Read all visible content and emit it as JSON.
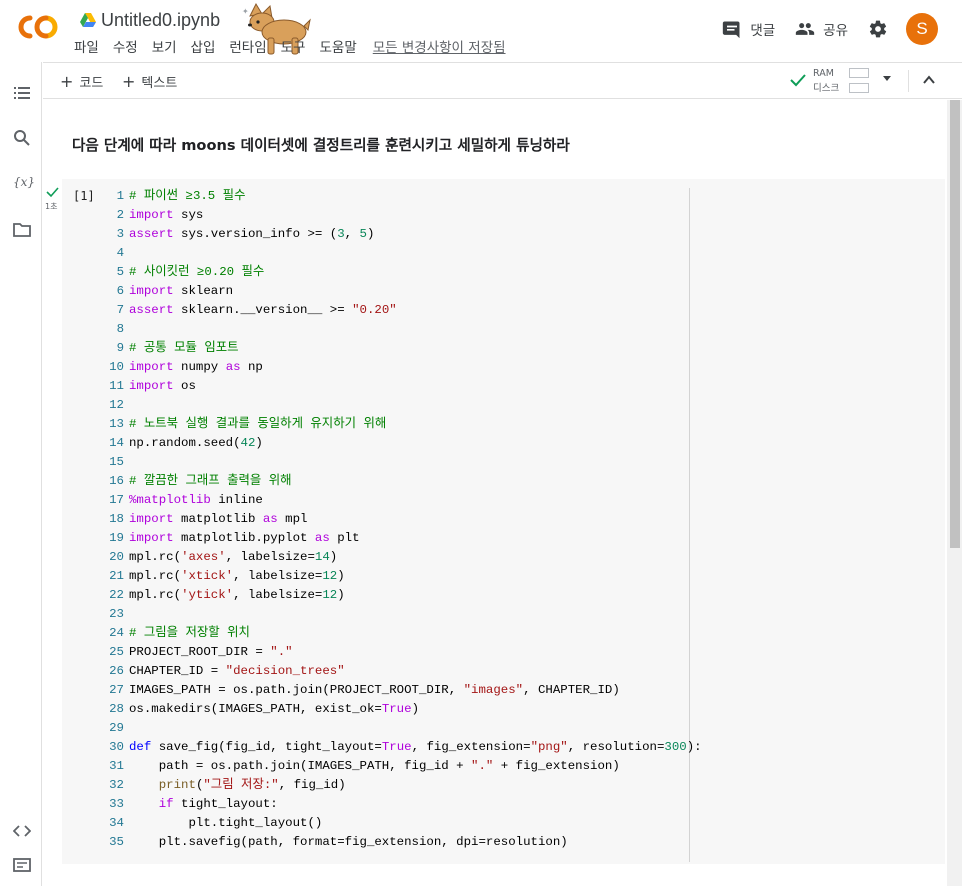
{
  "header": {
    "doc_title": "Untitled0.ipynb",
    "comments_label": "댓글",
    "share_label": "공유",
    "avatar_initial": "S",
    "save_status": "모든 변경사항이 저장됨"
  },
  "menu": {
    "items": [
      "파일",
      "수정",
      "보기",
      "삽입",
      "런타임",
      "도구",
      "도움말"
    ]
  },
  "toolbar": {
    "add_code_label": "코드",
    "add_text_label": "텍스트",
    "ram_label": "RAM",
    "disk_label": "디스크"
  },
  "notebook": {
    "markdown_heading": "다음 단계에 따라 moons 데이터셋에 결정트리를 훈련시키고 세밀하게 튜닝하라",
    "cell": {
      "execution_count": "[1]",
      "run_time": "1초",
      "lines": [
        "# 파이썬 ≥3.5 필수",
        "import sys",
        "assert sys.version_info >= (3, 5)",
        "",
        "# 사이킷런 ≥0.20 필수",
        "import sklearn",
        "assert sklearn.__version__ >= \"0.20\"",
        "",
        "# 공통 모듈 임포트",
        "import numpy as np",
        "import os",
        "",
        "# 노트북 실행 결과를 동일하게 유지하기 위해",
        "np.random.seed(42)",
        "",
        "# 깔끔한 그래프 출력을 위해",
        "%matplotlib inline",
        "import matplotlib as mpl",
        "import matplotlib.pyplot as plt",
        "mpl.rc('axes', labelsize=14)",
        "mpl.rc('xtick', labelsize=12)",
        "mpl.rc('ytick', labelsize=12)",
        "",
        "# 그림을 저장할 위치",
        "PROJECT_ROOT_DIR = \".\"",
        "CHAPTER_ID = \"decision_trees\"",
        "IMAGES_PATH = os.path.join(PROJECT_ROOT_DIR, \"images\", CHAPTER_ID)",
        "os.makedirs(IMAGES_PATH, exist_ok=True)",
        "",
        "def save_fig(fig_id, tight_layout=True, fig_extension=\"png\", resolution=300):",
        "    path = os.path.join(IMAGES_PATH, fig_id + \".\" + fig_extension)",
        "    print(\"그림 저장:\", fig_id)",
        "    if tight_layout:",
        "        plt.tight_layout()",
        "    plt.savefig(path, format=fig_extension, dpi=resolution)"
      ]
    }
  },
  "icons": {
    "logo": "colab-logo-icon",
    "drive": "drive-icon",
    "mascot": "corgi-mascot-icon",
    "comments": "comment-icon",
    "share": "people-icon",
    "settings": "gear-icon",
    "toc": "toc-icon",
    "search": "search-icon",
    "variables": "variables-icon",
    "files": "folder-icon",
    "code_snippets": "code-icon",
    "terminal": "terminal-icon"
  },
  "colors": {
    "accent_orange": "#e8710a",
    "logo_yellow": "#f9ab00",
    "check_green": "#0f9d58",
    "keyword": "#af00db",
    "comment": "#008000",
    "string": "#a31515",
    "number": "#098658"
  }
}
